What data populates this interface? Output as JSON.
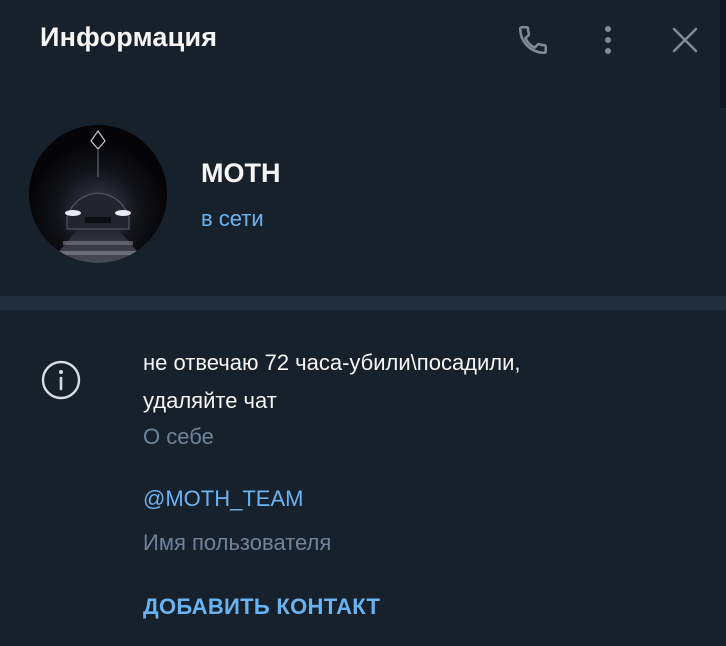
{
  "header": {
    "title": "Информация",
    "icons": [
      "phone-icon",
      "more-vertical-icon",
      "close-icon"
    ]
  },
  "profile": {
    "name": "MOTH",
    "status": "в сети"
  },
  "details": {
    "bio_text": "не отвечаю 72 часа-убили\\посадили,\nудаляйте чат",
    "bio_label": "О себе",
    "username": "@MOTH_TEAM",
    "username_label": "Имя пользователя",
    "add_contact": "ДОБАВИТЬ КОНТАКТ"
  },
  "colors": {
    "background": "#17212b",
    "divider": "#232e3c",
    "accent": "#6ab3f3",
    "text_primary": "#f5f5f5",
    "text_secondary": "#708499",
    "icon": "#7f8b96"
  }
}
